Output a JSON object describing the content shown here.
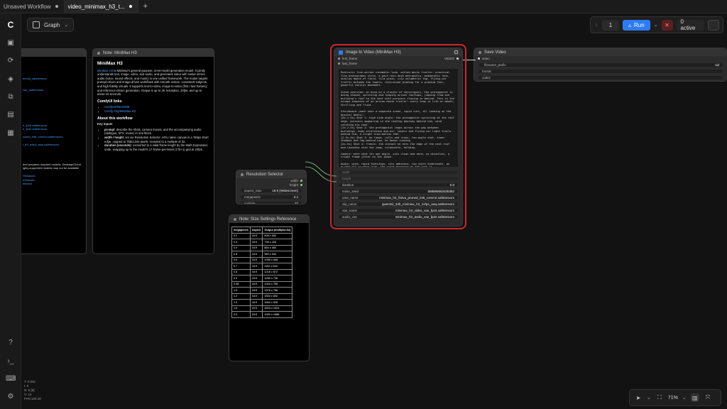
{
  "tabs": [
    {
      "label": "Unsaved Workflow"
    },
    {
      "label": "video_minimax_h3_t..."
    }
  ],
  "toolbar": {
    "graph_label": "Graph",
    "queue_count": "1",
    "run_label": "Run",
    "active_label": "0 active"
  },
  "rail_icons": [
    "comfy-logo-icon",
    "image-icon",
    "refresh-icon",
    "cube-icon",
    "nodes-icon",
    "template-icon",
    "layout-icon",
    "help-icon",
    "terminal-icon",
    "keyboard-icon",
    "settings-icon"
  ],
  "note_minimax": {
    "title": "Note: MiniMax H3",
    "heading": "MiniMax H3",
    "intro_link": "MiniMax H3",
    "intro": "is MiniMax's general-purpose, omni-model generation model. It jointly understands text, image, video, and audio, and generates video with native stereo audio (voice, sound effects, and music) in one unified framework. The model targets prompt-driven and image-driven workflows with smooth motion, consistent subjects, and high fidelity visuals. It supports text-to-video, image-to-video (first / last frames), and reference-driven generation. Output is up to 2K resolution, 24fps, and up to about 15 seconds.",
    "links_heading": "ComfyUI links",
    "links": [
      "ComfyUI/README",
      "Comfy-Org/MiniMax-H3"
    ],
    "about_heading": "About this workflow",
    "key_inputs": "Key inputs",
    "inputs": [
      {
        "name": "prompt",
        "desc": ": describe the shots, camera moves, and the accompanying audio (dialogue, SFX, music) in one block."
      },
      {
        "name": "width / height",
        "desc": ": set via Resolution Selector. H3's native canvas is a 768px short edge, capped at 768x1344 pixels, rounded to a multiple of 32."
      },
      {
        "name": "duration (seconds)",
        "desc": ": converted to a valid frame length by the Math Expression node, snapping up to the model's 17-frame-per-block (17k+1) grid at 24fps."
      }
    ]
  },
  "left_note": {
    "lines": [
      "",
      "",
      "",
      "",
      "",
      "ennuit_safetensors",
      "",
      "",
      "vae_safetensors",
      "",
      "",
      "",
      "",
      "",
      "",
      "",
      "",
      "e_fp16.safetensors",
      "e_fp32.safetensors",
      "",
      "ussed_int8_convrot.safetensors",
      "",
      "i_h3_nvfp4_awq.safetensors",
      "",
      "",
      "",
      "",
      "and prepares required models. Desktop/Cloud",
      "ighly-supported models may not be available",
      "",
      "H3/issues",
      "h3/issues",
      "discord"
    ]
  },
  "resolution_selector": {
    "title": "Resolution Selector",
    "out_width": "width",
    "out_height": "height",
    "aspect_ratio_label": "aspect_ratio",
    "aspect_ratio_value": "16:9 (Widescreen)",
    "megapixels_label": "megapixels",
    "megapixels_value": "0.4",
    "multiple_label": "multiple",
    "multiple_value": "32"
  },
  "size_reference": {
    "title": "Note: Size Settings Reference",
    "headers": [
      "megapixels",
      "Aspect",
      "Output (multiple=32)"
    ],
    "rows": [
      [
        "0.2",
        "16:9",
        "608 x 352"
      ],
      [
        "0.3",
        "16:9",
        "736 x 416"
      ],
      [
        "0.4",
        "16:9",
        "864 x 480"
      ],
      [
        "0.5",
        "16:9",
        "960 x 544"
      ],
      [
        "0.6",
        "16:9",
        "1056 x 608"
      ],
      [
        "0.7",
        "16:9",
        "1152 x 640"
      ],
      [
        "0.8",
        "16:9",
        "1216 x 672"
      ],
      [
        "0.9",
        "16:9",
        "1280 x 736"
      ],
      [
        "0.98",
        "16:9",
        "1344 x 768"
      ],
      [
        "1.0",
        "16:9",
        "1376 x 768"
      ],
      [
        "1.2",
        "16:9",
        "1504 x 832"
      ],
      [
        "1.3",
        "16:9",
        "1664 x 928"
      ],
      [
        "1.6",
        "16:9",
        "1824 x 1024"
      ],
      [
        "2.0",
        "16:9",
        "1920 x 1088"
      ]
    ]
  },
  "image_to_video": {
    "title": "Image to Video (MiniMax H3)",
    "in_first_frame": "first_frame",
    "in_last_frame": "last_frame",
    "out_video": "VIDEO",
    "prompt": "Realistic live-action cinematic look, action movie trailer: practical film photography style, a post-rain dusk metropolis, anamorphic lens, shallow depth of field, film grain, city volumetric fog, flying-car traffic between the towers, restrained grading for a premium feel, powerful natural movement.\n\nScene overview: at dusk on a cluster of skyscrapers, the protagonist is being chased, sprinting and leaping across rooftops, jumping from one building's roof to the next with pursuers closing in behind. This is the escape sequence of an action movie trailer: every leap is life-or-death, thrilling and fluid.\n\nStoryboard (each shot a separate scene, rapid cuts, all landing on the musical beats):\n[0s-1.5s] Shot 1: high side angle: the protagonist sprinting at the roof edge, pursuers appearing in the rooftop doorway behind him, wind catching his coat.\n[1s-2.5s] Shot 2: the protagonist leaps across the gap between buildings, body stretching mid-air, towers and flying-car light trails behind him, a slight slow-motion feel.\n[2.5s-4s] Shot 3: he lands, rolls and rises, low-angle shot, tower shadows and fog behind him, he keeps running.\n[4s-5s] Shot 4: freeze: the instant he hits the edge of the next roof and launches into the jump, silhouette, holding.\n\nCamera: each shot its own angle, cuts clean and hard, no dissolves, a slight frame jitter on the jumps.\n\nAudio: wind, rapid footsteps, city ambience, low score underneath, an accent hit on each leap, the score bursting at the last 1s.",
    "in_width": "width",
    "in_height": "height",
    "widgets": [
      {
        "label": "duration",
        "value": "5.0"
      },
      {
        "label": "noise_seed",
        "value": "558589552035382"
      },
      {
        "label": "unet_name",
        "value": "minimax_h3_f32va_pruned_int8_convrot.safetensors"
      },
      {
        "label": "clip_name",
        "value": "qwen3vl_32b_minimax_h3_nvfp4_awq.safetensors"
      },
      {
        "label": "vae_name",
        "value": "minimax_h3_video_vae_fp16.safetensors"
      },
      {
        "label": "audio_vae",
        "value": "minimax_h3_audio_vae_fp32.safetensors"
      }
    ]
  },
  "save_video": {
    "title": "Save Video",
    "in_video": "video",
    "filename_prefix_label": "filename_prefix",
    "filename_prefix_value": "vid",
    "format_label": "format",
    "codec_label": "codec"
  },
  "stats": [
    "T: 0.00s",
    "I: 0",
    "N: 6 [6]",
    "V: 13",
    "FPS:120.48"
  ],
  "zoom": {
    "value": "71%"
  },
  "colors": {
    "accent": "#2d7cf6",
    "highlight": "#d0262d",
    "link": "#4a9cff"
  }
}
